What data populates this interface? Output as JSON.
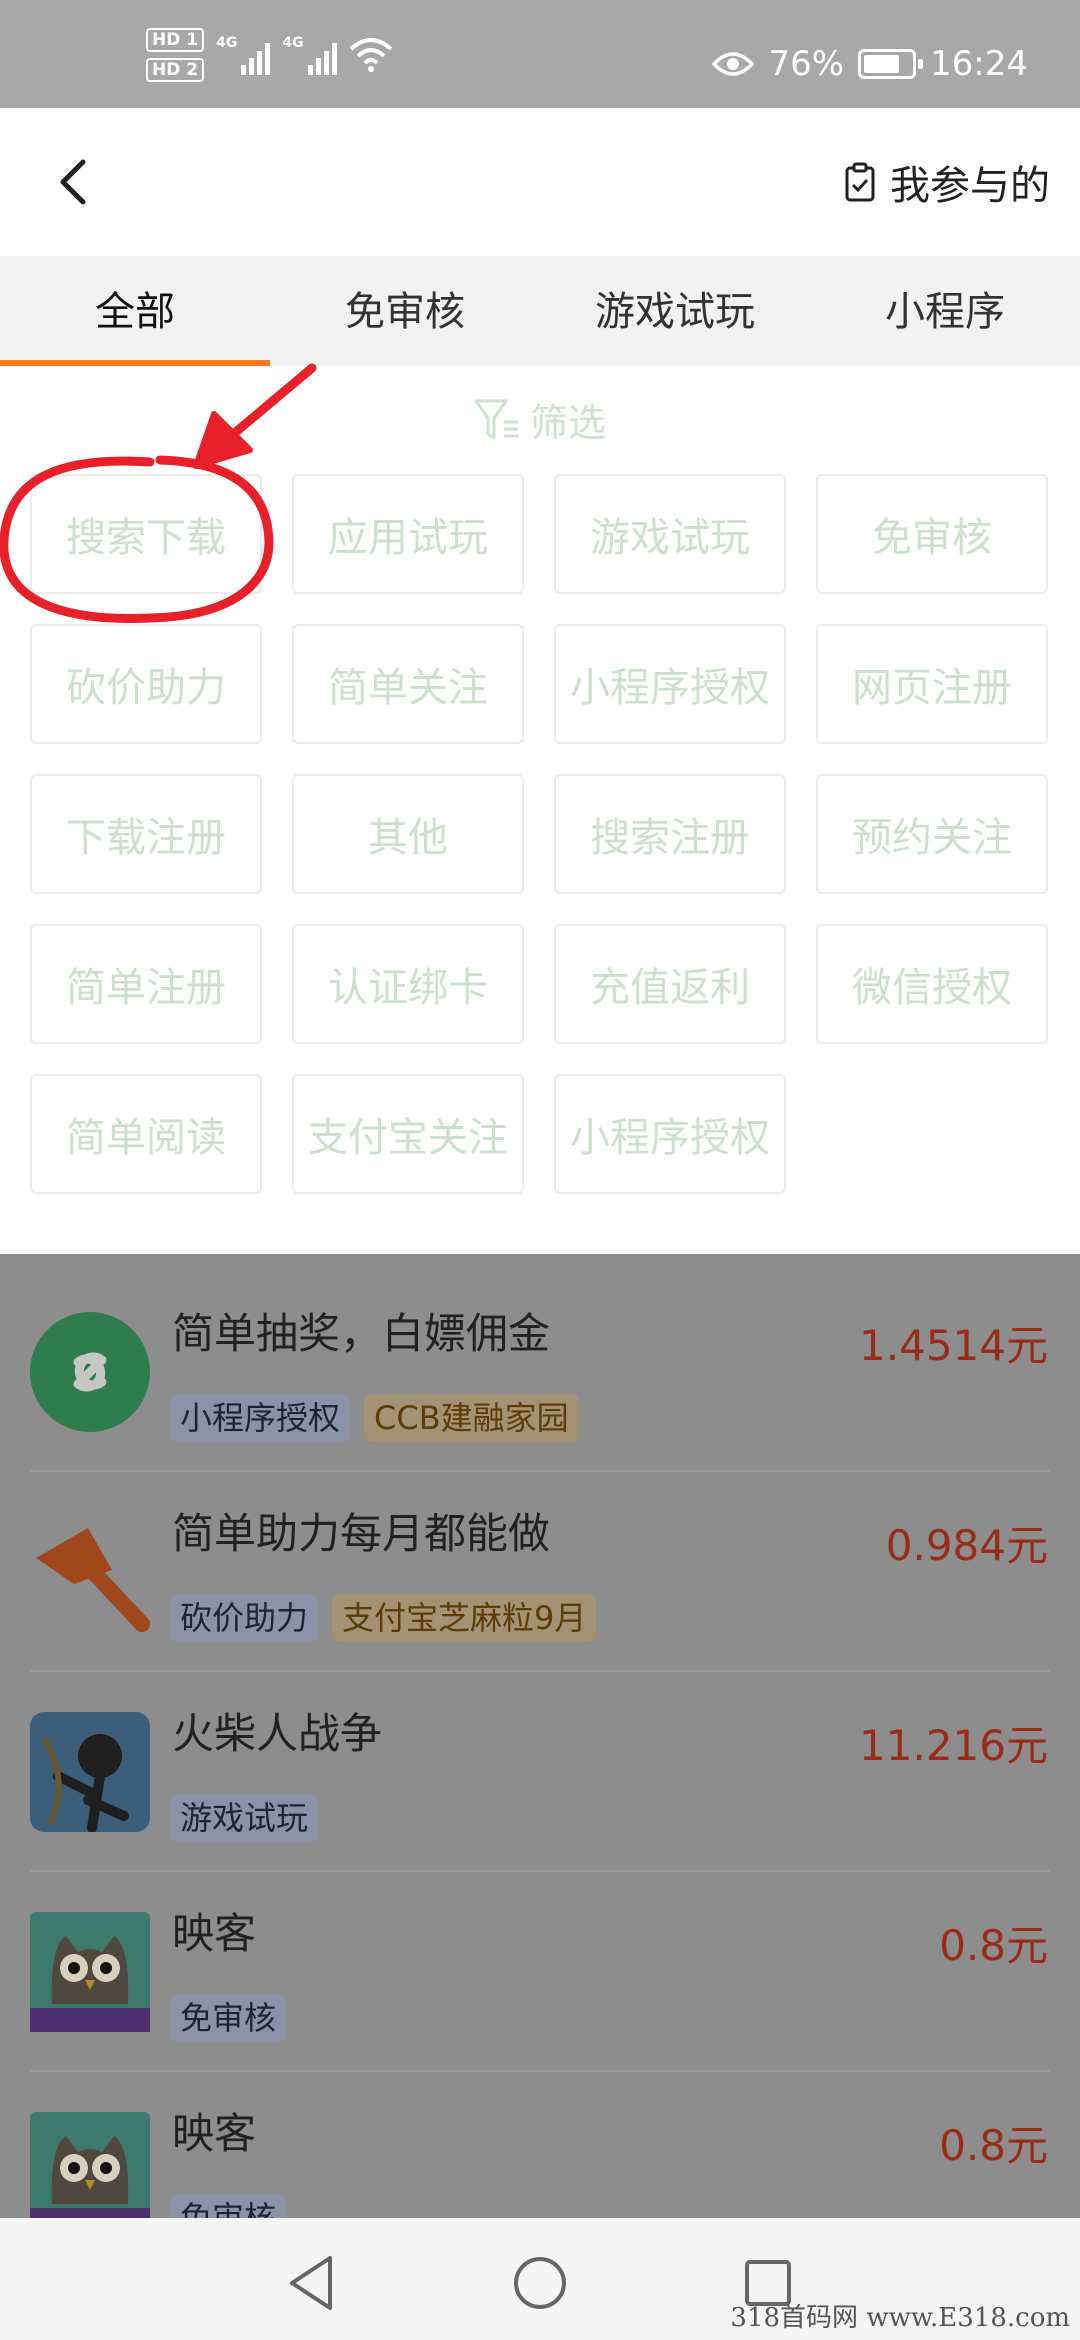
{
  "status_bar": {
    "hd1": "HD 1",
    "hd2": "HD 2",
    "net1": "4G",
    "net2": "4G",
    "battery_percent": "76%",
    "battery_level": 0.76,
    "time": "16:24"
  },
  "header": {
    "joined_label": "我参与的"
  },
  "tabs": [
    {
      "label": "全部",
      "active": true
    },
    {
      "label": "免审核",
      "active": false
    },
    {
      "label": "游戏试玩",
      "active": false
    },
    {
      "label": "小程序",
      "active": false
    }
  ],
  "filter": {
    "title": "筛选",
    "chips": [
      "搜索下载",
      "应用试玩",
      "游戏试玩",
      "免审核",
      "砍价助力",
      "简单关注",
      "小程序授权",
      "网页注册",
      "下载注册",
      "其他",
      "搜索注册",
      "预约关注",
      "简单注册",
      "认证绑卡",
      "充值返利",
      "微信授权",
      "简单阅读",
      "支付宝关注",
      "小程序授权"
    ]
  },
  "tasks": [
    {
      "name": "简单抽奖，白嫖佣金",
      "price": "1.4514元",
      "tag": "小程序授权",
      "brand": "CCB建融家园",
      "icon": "mini-program-icon"
    },
    {
      "name": "简单助力每月都能做",
      "price": "0.984元",
      "tag": "砍价助力",
      "brand": "支付宝芝麻粒9月",
      "icon": "axe-icon"
    },
    {
      "name": "火柴人战争",
      "price": "11.216元",
      "tag": "游戏试玩",
      "brand": "",
      "icon": "stickman-game-icon"
    },
    {
      "name": "映客",
      "price": "0.8元",
      "tag": "免审核",
      "brand": "",
      "icon": "owl-app-icon"
    },
    {
      "name": "映客",
      "price": "0.8元",
      "tag": "免审核",
      "brand": "",
      "icon": "owl-app-icon"
    }
  ],
  "watermark": "318首码网 www.E318.com",
  "colors": {
    "accent": "#ff7a1a",
    "price": "#9a2a1a",
    "chip_text": "#cde0cd",
    "annotation": "#e8202a"
  }
}
